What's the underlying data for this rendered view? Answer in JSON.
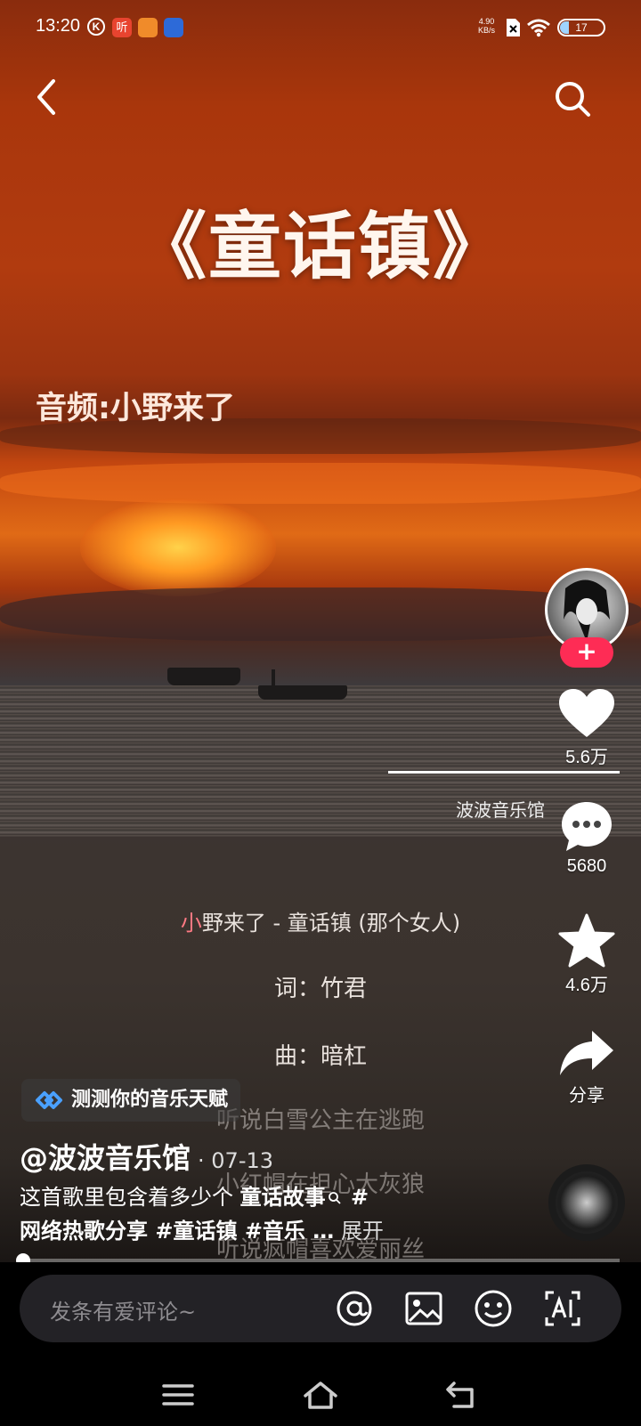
{
  "status_bar": {
    "time": "13:20",
    "app_icons": [
      "K",
      "听",
      "",
      ""
    ],
    "net_speed_value": "4.90",
    "net_speed_unit": "KB/s",
    "battery": "17"
  },
  "video": {
    "title": "《童话镇》",
    "audio_credit": "音频:小野来了",
    "watermark": "波波音乐馆",
    "lyrics_head_first_char": "小",
    "lyrics_head_rest": "野来了 - 童话镇 (那个女人)",
    "lyrics_words": "词：竹君",
    "lyrics_music": "曲：暗杠",
    "lyrics_faded": [
      "听说白雪公主在逃跑",
      "小红帽在担心大灰狼",
      "听说疯帽喜欢爱丽丝"
    ],
    "progress": 0.01
  },
  "rail": {
    "likes": "5.6万",
    "comments": "5680",
    "favorites": "4.6万",
    "share": "分享",
    "follow": "+"
  },
  "post": {
    "promo": "测测你的音乐天赋",
    "author": "@波波音乐馆",
    "date": "· 07-13",
    "caption_plain": "这首歌里包含着多少个 ",
    "caption_link": "童话故事",
    "caption_tag1": " #",
    "caption_line2": "网络热歌分享 #童话镇 #音乐 …",
    "expand": "展开"
  },
  "comment_bar": {
    "placeholder": "发条有爱评论~"
  },
  "colors": {
    "accent": "#fe2c55",
    "comment_bar_bg": "#232226"
  }
}
